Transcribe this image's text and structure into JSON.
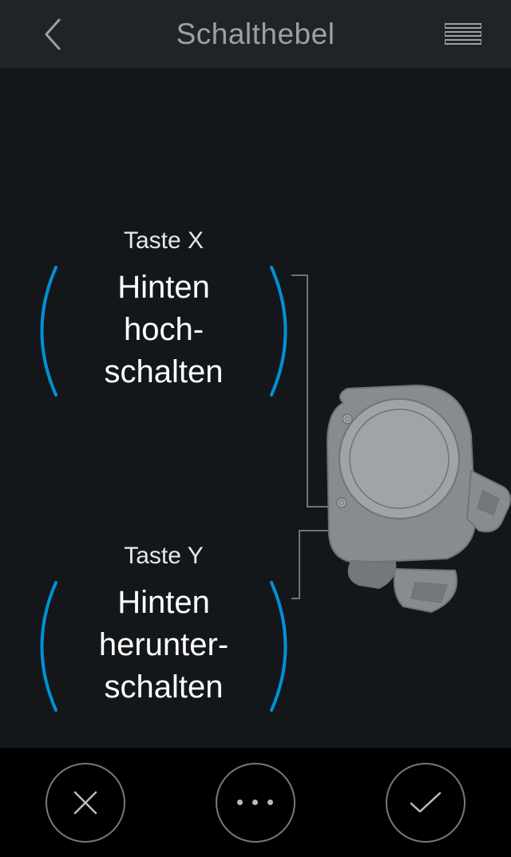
{
  "header": {
    "title": "Schalthebel"
  },
  "buttons": {
    "x": {
      "label": "Taste X",
      "action": "Hinten\nhoch-\nschalten"
    },
    "y": {
      "label": "Taste Y",
      "action": "Hinten\nherunter-\nschalten"
    }
  },
  "colors": {
    "accent": "#0091d4"
  }
}
